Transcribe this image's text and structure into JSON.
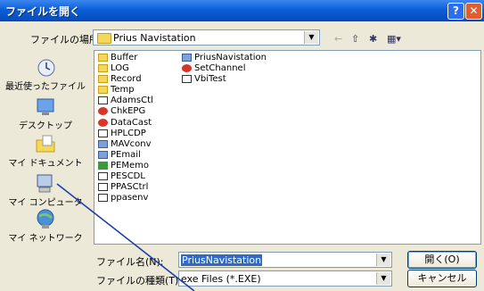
{
  "window": {
    "title": "ファイルを開く",
    "help": "?",
    "close": "✕"
  },
  "lookin": {
    "label": "ファイルの場所(I):",
    "value": "Prius Navistation"
  },
  "places": [
    {
      "label": "最近使ったファイル",
      "icon": "recent-icon"
    },
    {
      "label": "デスクトップ",
      "icon": "desktop-icon"
    },
    {
      "label": "マイ ドキュメント",
      "icon": "my-documents-icon"
    },
    {
      "label": "マイ コンピュータ",
      "icon": "my-computer-icon"
    },
    {
      "label": "マイ ネットワーク",
      "icon": "my-network-icon"
    }
  ],
  "files_col1": [
    {
      "name": "Buffer",
      "icon": "folder"
    },
    {
      "name": "LOG",
      "icon": "folder"
    },
    {
      "name": "Record",
      "icon": "folder"
    },
    {
      "name": "Temp",
      "icon": "folder"
    },
    {
      "name": "AdamsCtl",
      "icon": "app"
    },
    {
      "name": "ChkEPG",
      "icon": "red"
    },
    {
      "name": "DataCast",
      "icon": "red"
    },
    {
      "name": "HPLCDP",
      "icon": "app"
    },
    {
      "name": "MAVconv",
      "icon": "exe"
    },
    {
      "name": "PEmail",
      "icon": "exe"
    },
    {
      "name": "PEMemo",
      "icon": "green"
    },
    {
      "name": "PESCDL",
      "icon": "app"
    },
    {
      "name": "PPASCtrl",
      "icon": "app"
    },
    {
      "name": "ppasenv",
      "icon": "app"
    }
  ],
  "files_col2": [
    {
      "name": "PriusNavistation",
      "icon": "exe"
    },
    {
      "name": "SetChannel",
      "icon": "red"
    },
    {
      "name": "VbiTest",
      "icon": "app"
    }
  ],
  "filename": {
    "label": "ファイル名(N):",
    "value": "PriusNavistation"
  },
  "filetype": {
    "label": "ファイルの種類(T):",
    "value": "exe Files (*.EXE)"
  },
  "buttons": {
    "open": "開く(O)",
    "cancel": "キャンセル"
  }
}
